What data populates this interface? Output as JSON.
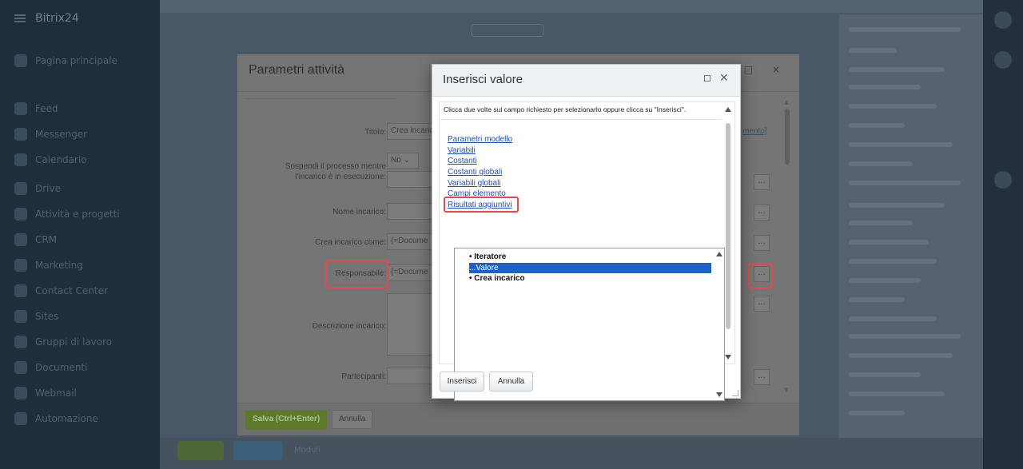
{
  "app": {
    "brand": "Bitrix24",
    "sidebar_items": [
      "Pagina principale",
      "",
      "Feed",
      "Messenger",
      "Calendario",
      "Drive",
      "Attività e progetti",
      "CRM",
      "Marketing",
      "Contact Center",
      "Sites",
      "Gruppi di lavoro",
      "Documenti",
      "Webmail",
      "Automazione"
    ],
    "bottom_bar_label": "Moduli"
  },
  "outer_dialog": {
    "title": "Parametri attività",
    "fields": {
      "title_label": "Titolo:",
      "title_value": "Crea incaric",
      "title_link": "mento]",
      "suspend_label": "Sospendi il processo mentre l'incarico è in esecuzione:",
      "suspend_value": "No",
      "task_name_label": "Nome incarico:",
      "create_as_label": "Crea incarico come:",
      "create_as_value": "{=Docume",
      "responsible_label": "Responsabile:",
      "responsible_value": "{=Docume",
      "description_label": "Descrizione incarico:",
      "participants_label": "Partecipanti:"
    },
    "dots_label": "...",
    "save_label": "Salva (Ctrl+Enter)",
    "cancel_label": "Annulla"
  },
  "inner_dialog": {
    "title": "Inserisci valore",
    "hint": "Clicca due volte sul campo richiesto per selezionarlo oppure clicca su \"Inserisci\".",
    "categories": [
      "Parametri modello",
      "Variabili",
      "Costanti",
      "Costanti globali",
      "Variabili globali",
      "Campi elemento",
      "Risultati aggiuntivi"
    ],
    "tree": {
      "item1": "• Iteratore",
      "item2": "...Valore",
      "item3": "• Crea incarico"
    },
    "insert_label": "Inserisci",
    "cancel_label": "Annulla"
  },
  "colors": {
    "highlight": "#e9474d",
    "selection": "#1c61c9",
    "link": "#1d4fb3",
    "save_button": "#5d7a2a"
  }
}
